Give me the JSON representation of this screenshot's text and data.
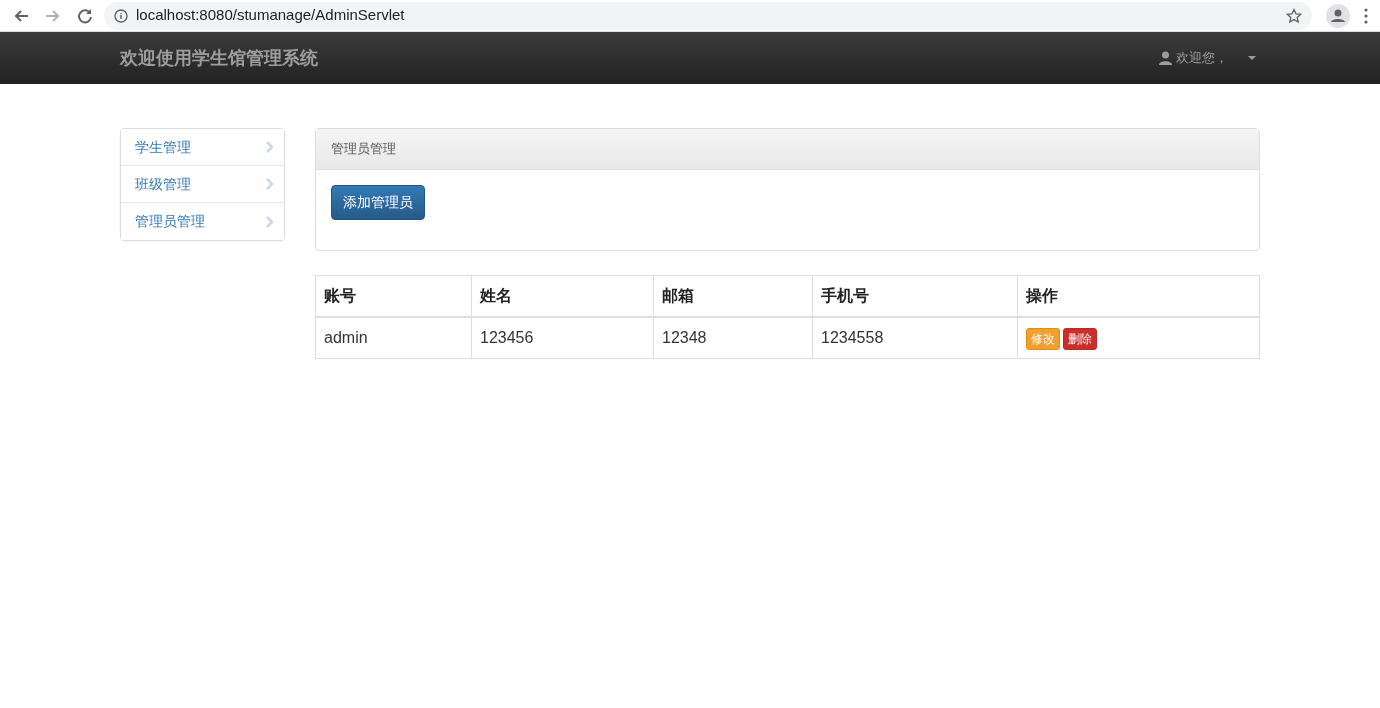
{
  "browser": {
    "url": "localhost:8080/stumanage/AdminServlet"
  },
  "navbar": {
    "brand": "欢迎使用学生馆管理系统",
    "user_menu": "欢迎您，"
  },
  "sidebar": {
    "items": [
      {
        "label": "学生管理",
        "selected": false
      },
      {
        "label": "班级管理",
        "selected": false
      },
      {
        "label": "管理员管理",
        "selected": false
      }
    ]
  },
  "panel": {
    "title": "管理员管理",
    "add_button": "添加管理员"
  },
  "table": {
    "columns": [
      "账号",
      "姓名",
      "邮箱",
      "手机号",
      "操作"
    ],
    "rows": [
      {
        "cells": [
          "admin",
          "123456",
          "12348",
          "1234558"
        ],
        "actions": [
          {
            "label": "修改",
            "kind": "edit"
          },
          {
            "label": "删除",
            "kind": "delete"
          }
        ]
      }
    ]
  }
}
